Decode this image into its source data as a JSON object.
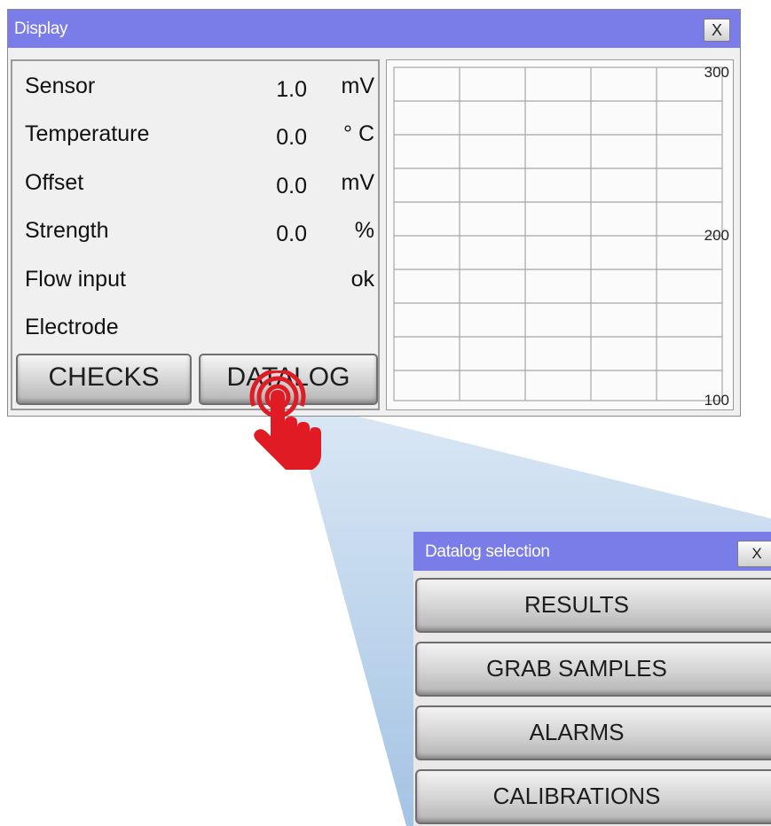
{
  "display_window": {
    "title": "Display",
    "close_label": "X",
    "readings": [
      {
        "label": "Sensor",
        "value": "1.0",
        "unit": "mV"
      },
      {
        "label": "Temperature",
        "value": "0.0",
        "unit": "° C"
      },
      {
        "label": "Offset",
        "value": "0.0",
        "unit": "mV"
      },
      {
        "label": "Strength",
        "value": "0.0",
        "unit": "%"
      },
      {
        "label": "Flow input",
        "value": "",
        "unit": "ok"
      },
      {
        "label": "Electrode",
        "value": "",
        "unit": ""
      }
    ],
    "checks_label": "CHECKS",
    "datalog_label": "DATALOG",
    "trend": {
      "y_top": "300",
      "y_mid": "200",
      "y_bottom": "100"
    }
  },
  "datalog_window": {
    "title": "Datalog selection",
    "close_label": "X",
    "options": [
      "RESULTS",
      "GRAB SAMPLES",
      "ALARMS",
      "CALIBRATIONS"
    ]
  },
  "colors": {
    "titlebar": "#7a7ce8",
    "tap_icon": "#e01b24",
    "zoom_beam": "#aecbe8"
  },
  "icons": {
    "tap": "hand-tap-icon"
  }
}
